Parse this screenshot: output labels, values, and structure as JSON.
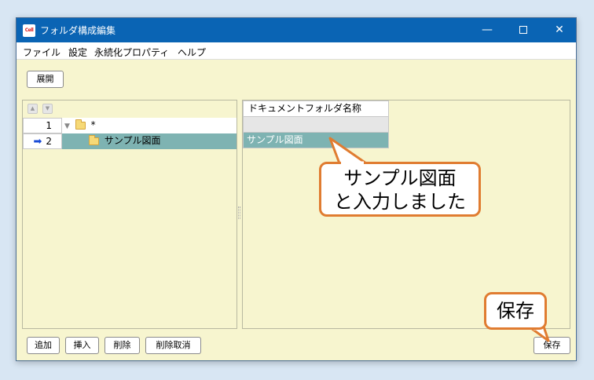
{
  "window": {
    "title": "フォルダ構成編集",
    "icon_text": "Cell",
    "controls": {
      "minimize": "—",
      "close": "✕"
    }
  },
  "menu": [
    "ファイル",
    "設定",
    "永続化プロパティ",
    "ヘルプ"
  ],
  "toolbar": {
    "expand_label": "展開"
  },
  "tree": {
    "move_up": "▲",
    "move_down": "▼",
    "rows": [
      {
        "num": "1",
        "expander": "▼",
        "label": "*"
      },
      {
        "num": "2",
        "marker": "➡",
        "label": "サンプル図面"
      }
    ]
  },
  "grid": {
    "header": "ドキュメントフォルダ名称",
    "rows": [
      "",
      "サンプル図面"
    ]
  },
  "bottom_buttons": {
    "add": "追加",
    "insert": "挿入",
    "delete": "削除",
    "undo_delete": "削除取消",
    "save": "保存"
  },
  "callouts": {
    "main_line1": "サンプル図面",
    "main_line2": "と入力しました",
    "save": "保存"
  },
  "colors": {
    "titlebar": "#0a64b4",
    "background": "#f7f5cf",
    "selection": "#7eb3b2",
    "callout_border": "#e07c31"
  }
}
